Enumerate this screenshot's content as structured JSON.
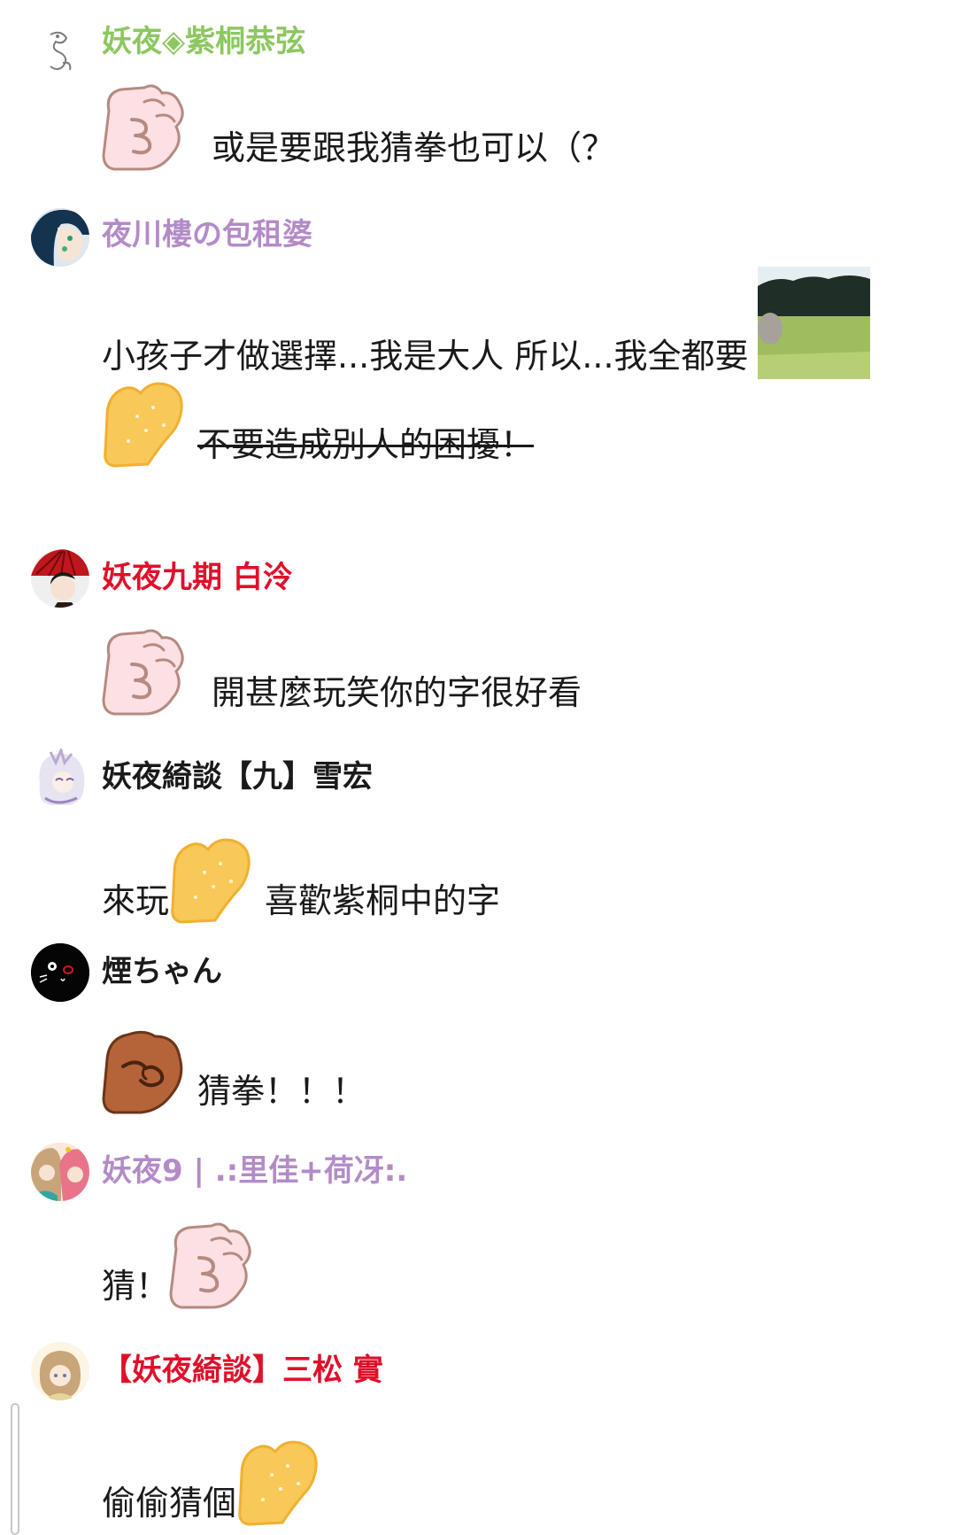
{
  "colors": {
    "green_name": "#8cc760",
    "purple_name": "#b38bc7",
    "red_name": "#e0102a",
    "black_name": "#1a1a1a",
    "pink_sticker": "#fde0e3",
    "pink_outline": "#b58a80",
    "yellow_sticker": "#f8c858",
    "yellow_outline": "#f0b030",
    "brown_sticker": "#b5643a",
    "brown_outline": "#6d3418"
  },
  "messages": [
    {
      "user": "妖夜◈紫桐恭弦",
      "avatar": "sketch-avatar",
      "lines": [
        {
          "sticker_before": "rock-pink-sticker",
          "text": "或是要跟我猜拳也可以（？"
        }
      ]
    },
    {
      "user": "夜川樓の包租婆",
      "avatar": "blue-hair-avatar",
      "lines": [
        {
          "text": "小孩子才做選擇...我是大人 所以...我全都要",
          "photo_after": "grass-photo"
        },
        {
          "sticker_before": "paper-yellow-sticker",
          "text": "不要造成別人的困擾！"
        }
      ]
    },
    {
      "user": "妖夜九期 白泠",
      "avatar": "red-umbrella-avatar",
      "lines": [
        {
          "sticker_before": "rock-pink-sticker",
          "text": "開甚麼玩笑你的字很好看"
        }
      ]
    },
    {
      "user": "妖夜綺談【九】雪宏",
      "avatar": "white-hair-avatar",
      "lines": [
        {
          "text": "來玩",
          "sticker_mid": "paper-yellow-sticker",
          "text_after": "喜歡紫桐中的字"
        }
      ]
    },
    {
      "user": "煙ちゃん",
      "avatar": "black-cat-avatar",
      "lines": [
        {
          "sticker_before": "fist-brown-sticker",
          "text": "猜拳！！！"
        }
      ]
    },
    {
      "user": "妖夜9 | .:里佳+荷冴:.",
      "avatar": "duo-avatar",
      "lines": [
        {
          "text": "猜！",
          "sticker_after": "rock-pink-sticker"
        }
      ]
    },
    {
      "user": "【妖夜綺談】三松 實",
      "avatar": "blonde-avatar",
      "lines": [
        {
          "text": "偷偷猜個",
          "sticker_after": "paper-yellow-sticker"
        }
      ]
    }
  ]
}
